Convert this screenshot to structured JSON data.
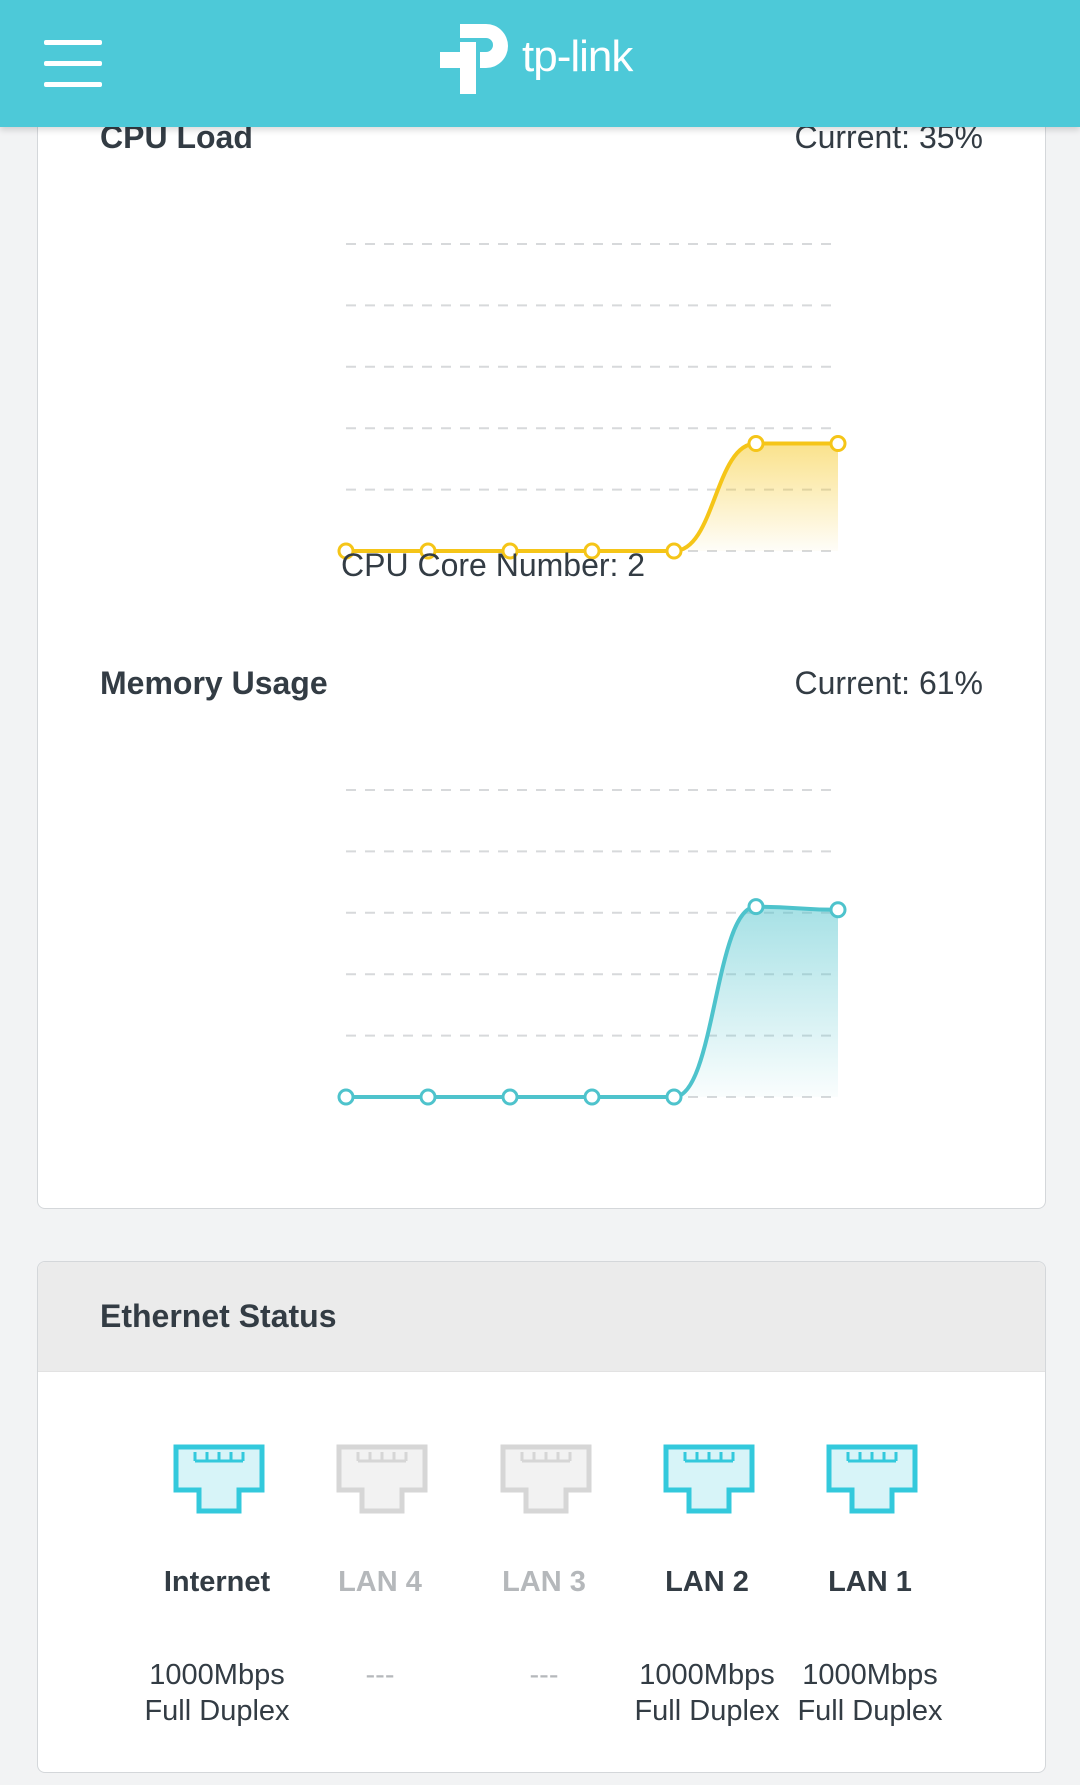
{
  "header": {
    "logo_text": "tp-link"
  },
  "cpu": {
    "title": "CPU Load",
    "current": "Current: 35%",
    "core_label": "CPU Core Number: 2",
    "chart_data": {
      "type": "area",
      "values": [
        0,
        0,
        0,
        0,
        0,
        35,
        35
      ],
      "ylim": [
        0,
        100
      ],
      "grid": true,
      "color": "#f5c518"
    }
  },
  "memory": {
    "title": "Memory Usage",
    "current": "Current: 61%",
    "chart_data": {
      "type": "area",
      "values": [
        0,
        0,
        0,
        0,
        0,
        62,
        61
      ],
      "ylim": [
        0,
        100
      ],
      "grid": true,
      "color": "#4ec3cc"
    }
  },
  "ethernet": {
    "title": "Ethernet Status",
    "ports": [
      {
        "label": "Internet",
        "status": "active",
        "speed": "1000Mbps",
        "duplex": "Full Duplex"
      },
      {
        "label": "LAN 4",
        "status": "inactive",
        "speed": "---",
        "duplex": ""
      },
      {
        "label": "LAN 3",
        "status": "inactive",
        "speed": "---",
        "duplex": ""
      },
      {
        "label": "LAN 2",
        "status": "active",
        "speed": "1000Mbps",
        "duplex": "Full Duplex"
      },
      {
        "label": "LAN 1",
        "status": "active",
        "speed": "1000Mbps",
        "duplex": "Full Duplex"
      }
    ]
  },
  "colors": {
    "accent": "#4dc9d8",
    "cpu_line": "#f5c518",
    "memory_line": "#4ec3cc",
    "inactive": "#d8d8d8"
  }
}
